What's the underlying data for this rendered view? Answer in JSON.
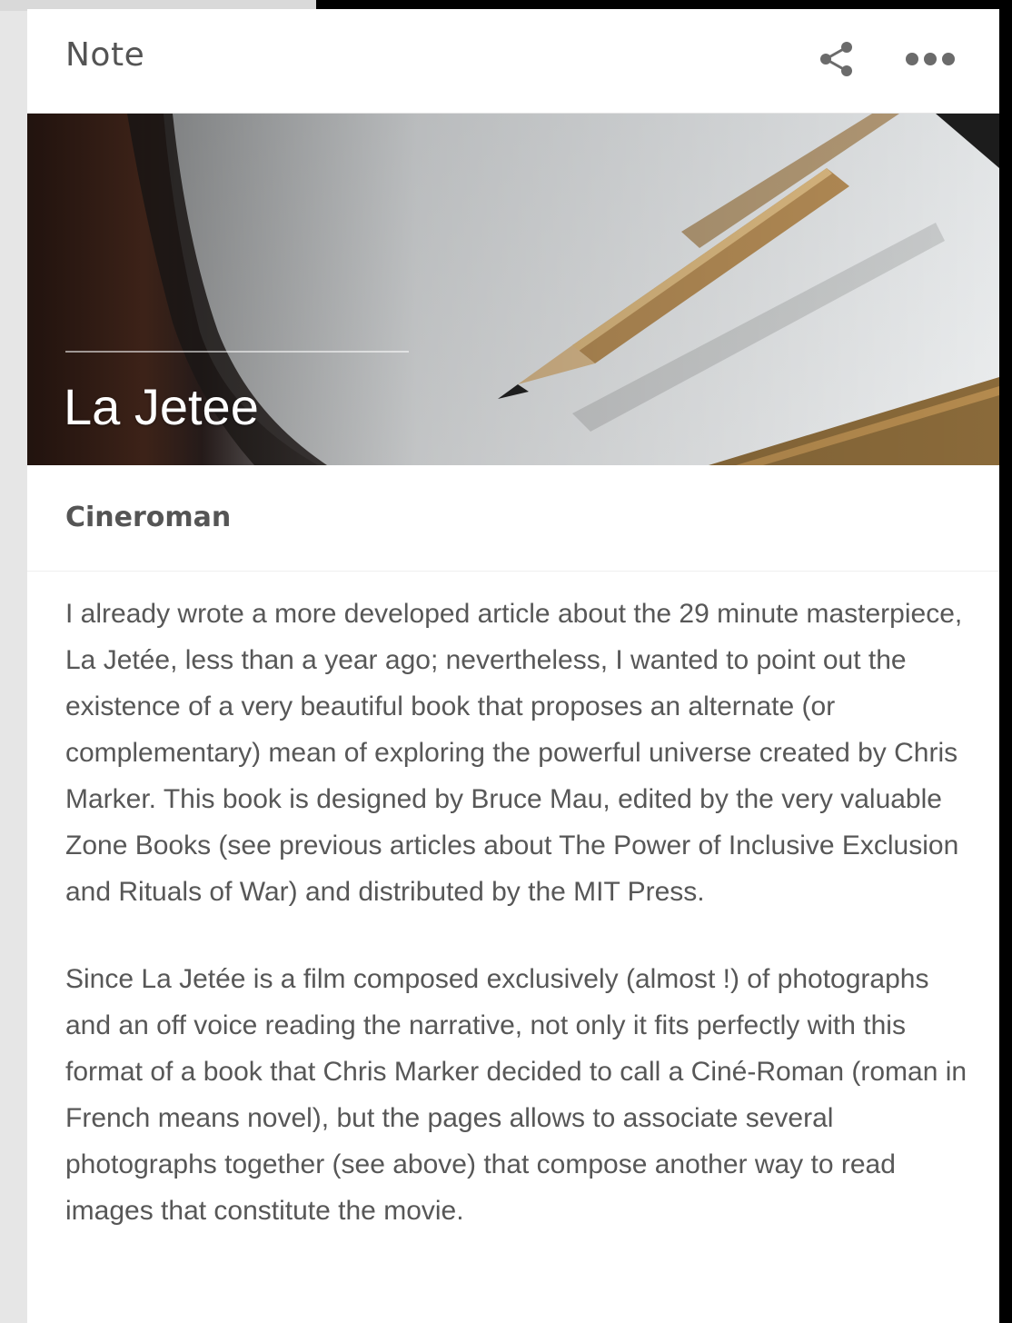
{
  "header": {
    "title": "Note",
    "share_icon": "share-icon",
    "more_icon": "more-options-icon"
  },
  "hero": {
    "title": "La Jetee",
    "image": "notebook-and-pencil-photo"
  },
  "subtitle": "Cineroman",
  "body": {
    "paragraphs": [
      "I already wrote a more developed article about the 29 minute masterpiece, La Jetée, less than a year ago; nevertheless, I wanted to point out the existence of a very beautiful book that proposes an alternate (or complementary) mean of exploring the powerful universe created by Chris Marker. This book is designed by Bruce Mau, edited by the very valuable Zone Books (see previous articles about The Power of Inclusive Exclusion and Rituals of War) and distributed by the MIT Press.",
      "Since La Jetée is a film composed exclusively (almost !) of photographs and an off voice reading the narrative, not only it fits perfectly with this format of a book that Chris Marker decided to call a Ciné-Roman (roman in French means novel), but the pages allows to associate several photographs together (see above) that compose another way to read images that constitute the movie."
    ]
  }
}
